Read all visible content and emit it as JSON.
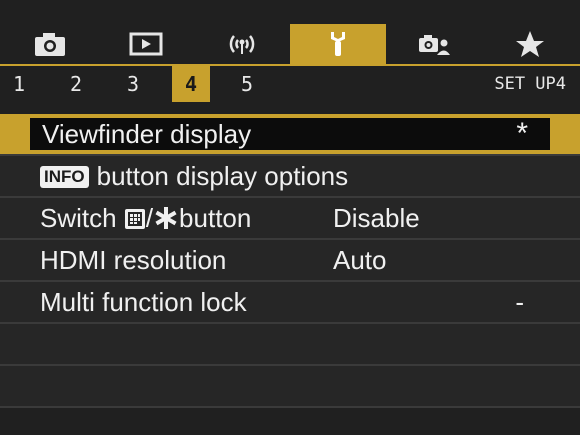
{
  "tabs": [
    {
      "icon": "camera-icon",
      "active": false
    },
    {
      "icon": "playback-icon",
      "active": false
    },
    {
      "icon": "wireless-icon",
      "active": false
    },
    {
      "icon": "wrench-icon",
      "active": true
    },
    {
      "icon": "custom-functions-icon",
      "active": false
    },
    {
      "icon": "star-icon",
      "active": false
    }
  ],
  "pages": {
    "numbers": [
      "1",
      "2",
      "3",
      "4",
      "5"
    ],
    "active_index": 3,
    "label": "SET UP4"
  },
  "menu": {
    "items": [
      {
        "label": "Viewfinder display",
        "value": "*",
        "selected": true
      },
      {
        "badge": "INFO",
        "label": "button display options",
        "value": ""
      },
      {
        "label_pre": "Switch",
        "label_post": "button",
        "value": "Disable"
      },
      {
        "label": "HDMI resolution",
        "value": "Auto"
      },
      {
        "label": "Multi function lock",
        "value": "-"
      }
    ]
  },
  "colors": {
    "accent": "#c8a12d",
    "background": "#202020",
    "row_background": "#262626",
    "selected_inner": "#0c0c0c",
    "text": "#f0f0f0"
  }
}
